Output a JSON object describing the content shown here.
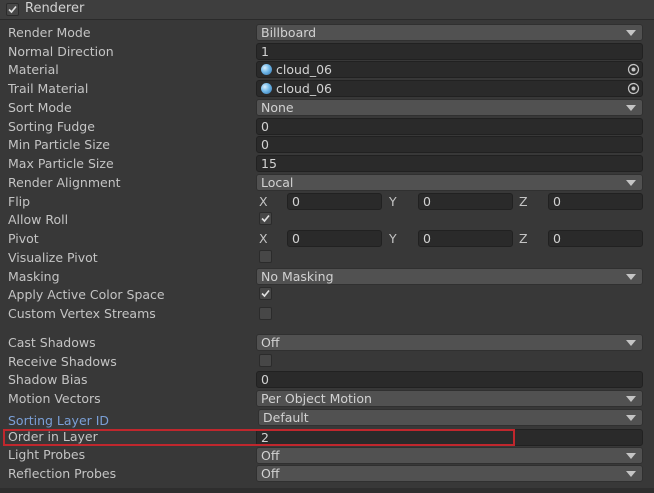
{
  "header": {
    "title": "Renderer",
    "enabled": true
  },
  "rows": {
    "render_mode": {
      "label": "Render Mode",
      "value": "Billboard"
    },
    "normal_direction": {
      "label": "Normal Direction",
      "value": "1"
    },
    "material": {
      "label": "Material",
      "value": "cloud_06"
    },
    "trail_material": {
      "label": "Trail Material",
      "value": "cloud_06"
    },
    "sort_mode": {
      "label": "Sort Mode",
      "value": "None"
    },
    "sorting_fudge": {
      "label": "Sorting Fudge",
      "value": "0"
    },
    "min_particle_size": {
      "label": "Min Particle Size",
      "value": "0"
    },
    "max_particle_size": {
      "label": "Max Particle Size",
      "value": "15"
    },
    "render_alignment": {
      "label": "Render Alignment",
      "value": "Local"
    },
    "flip": {
      "label": "Flip",
      "x": "0",
      "y": "0",
      "z": "0"
    },
    "allow_roll": {
      "label": "Allow Roll",
      "checked": true
    },
    "pivot": {
      "label": "Pivot",
      "x": "0",
      "y": "0",
      "z": "0"
    },
    "visualize_pivot": {
      "label": "Visualize Pivot",
      "checked": false
    },
    "masking": {
      "label": "Masking",
      "value": "No Masking"
    },
    "apply_active_color_space": {
      "label": "Apply Active Color Space",
      "checked": true
    },
    "custom_vertex_streams": {
      "label": "Custom Vertex Streams",
      "checked": false
    },
    "cast_shadows": {
      "label": "Cast Shadows",
      "value": "Off"
    },
    "receive_shadows": {
      "label": "Receive Shadows",
      "checked": false
    },
    "shadow_bias": {
      "label": "Shadow Bias",
      "value": "0"
    },
    "motion_vectors": {
      "label": "Motion Vectors",
      "value": "Per Object Motion"
    },
    "sorting_layer_id": {
      "label": "Sorting Layer ID",
      "value": "Default"
    },
    "order_in_layer": {
      "label": "Order in Layer",
      "value": "2"
    },
    "light_probes": {
      "label": "Light Probes",
      "value": "Off"
    },
    "reflection_probes": {
      "label": "Reflection Probes",
      "value": "Off"
    }
  },
  "axis_labels": {
    "x": "X",
    "y": "Y",
    "z": "Z"
  },
  "colors": {
    "background": "#383838",
    "field": "#2a2a2a",
    "dropdown": "#515151",
    "highlight": "#c0272d",
    "link": "#7a9fd6"
  }
}
